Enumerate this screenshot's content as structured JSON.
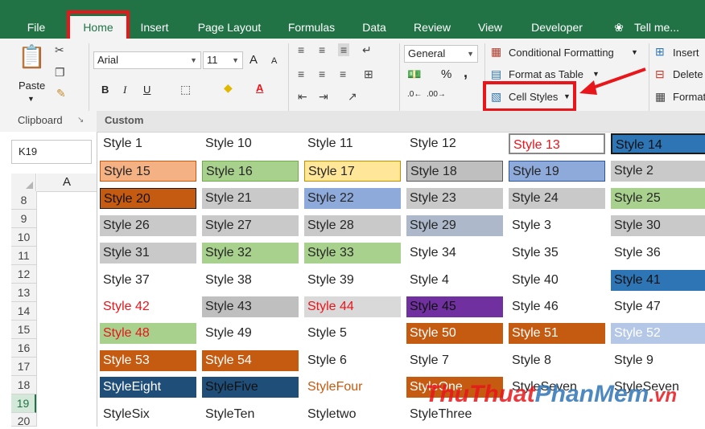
{
  "tabs": [
    "File",
    "Home",
    "Insert",
    "Page Layout",
    "Formulas",
    "Data",
    "Review",
    "View",
    "Developer",
    "Tell me..."
  ],
  "font": {
    "name": "Arial",
    "size": "11",
    "bold": "B",
    "italic": "I",
    "underline": "U",
    "grow": "A",
    "shrink": "A"
  },
  "number": {
    "format": "General",
    "percent": "%",
    "comma": ","
  },
  "styles_group": {
    "conditional": "Conditional Formatting",
    "format_table": "Format as Table",
    "cell_styles": "Cell Styles"
  },
  "cells_group": {
    "insert": "Insert",
    "delete": "Delete",
    "format": "Format"
  },
  "clipboard": {
    "paste": "Paste",
    "label": "Clipboard"
  },
  "namebox": "K19",
  "column_a": "A",
  "rows": [
    "8",
    "9",
    "10",
    "11",
    "12",
    "13",
    "14",
    "15",
    "16",
    "17",
    "18",
    "19",
    "20"
  ],
  "gallery_header": "Custom",
  "gallery": [
    [
      "Style 1",
      "Style 10",
      "Style 11",
      "Style 12",
      "Style 13",
      "Style 14"
    ],
    [
      "Style 15",
      "Style 16",
      "Style 17",
      "Style 18",
      "Style 19",
      "Style 2"
    ],
    [
      "Style 20",
      "Style 21",
      "Style 22",
      "Style 23",
      "Style 24",
      "Style 25"
    ],
    [
      "Style 26",
      "Style 27",
      "Style 28",
      "Style 29",
      "Style 3",
      "Style 30"
    ],
    [
      "Style 31",
      "Style 32",
      "Style 33",
      "Style 34",
      "Style 35",
      "Style 36"
    ],
    [
      "Style 37",
      "Style 38",
      "Style 39",
      "Style 4",
      "Style 40",
      "Style 41"
    ],
    [
      "Style 42",
      "Style 43",
      "Style 44",
      "Style 45",
      "Style 46",
      "Style 47"
    ],
    [
      "Style 48",
      "Style 49",
      "Style 5",
      "Style 50",
      "Style 51",
      "Style 52"
    ],
    [
      "Style 53",
      "Style 54",
      "Style 6",
      "Style 7",
      "Style 8",
      "Style 9"
    ],
    [
      "StyleEight",
      "StyleFive",
      "StyleFour",
      "StyleOne",
      "StyleSeven",
      "StyleSeven"
    ],
    [
      "StyleSix",
      "StyleTen",
      "Styletwo",
      "StyleThree",
      "",
      ""
    ]
  ],
  "watermark": {
    "part1": "ThuThuat",
    "part2": "PhanMem",
    ".vn": ".vn"
  },
  "colors": {
    "excel_green": "#217346",
    "highlight_red": "#e8161b"
  }
}
